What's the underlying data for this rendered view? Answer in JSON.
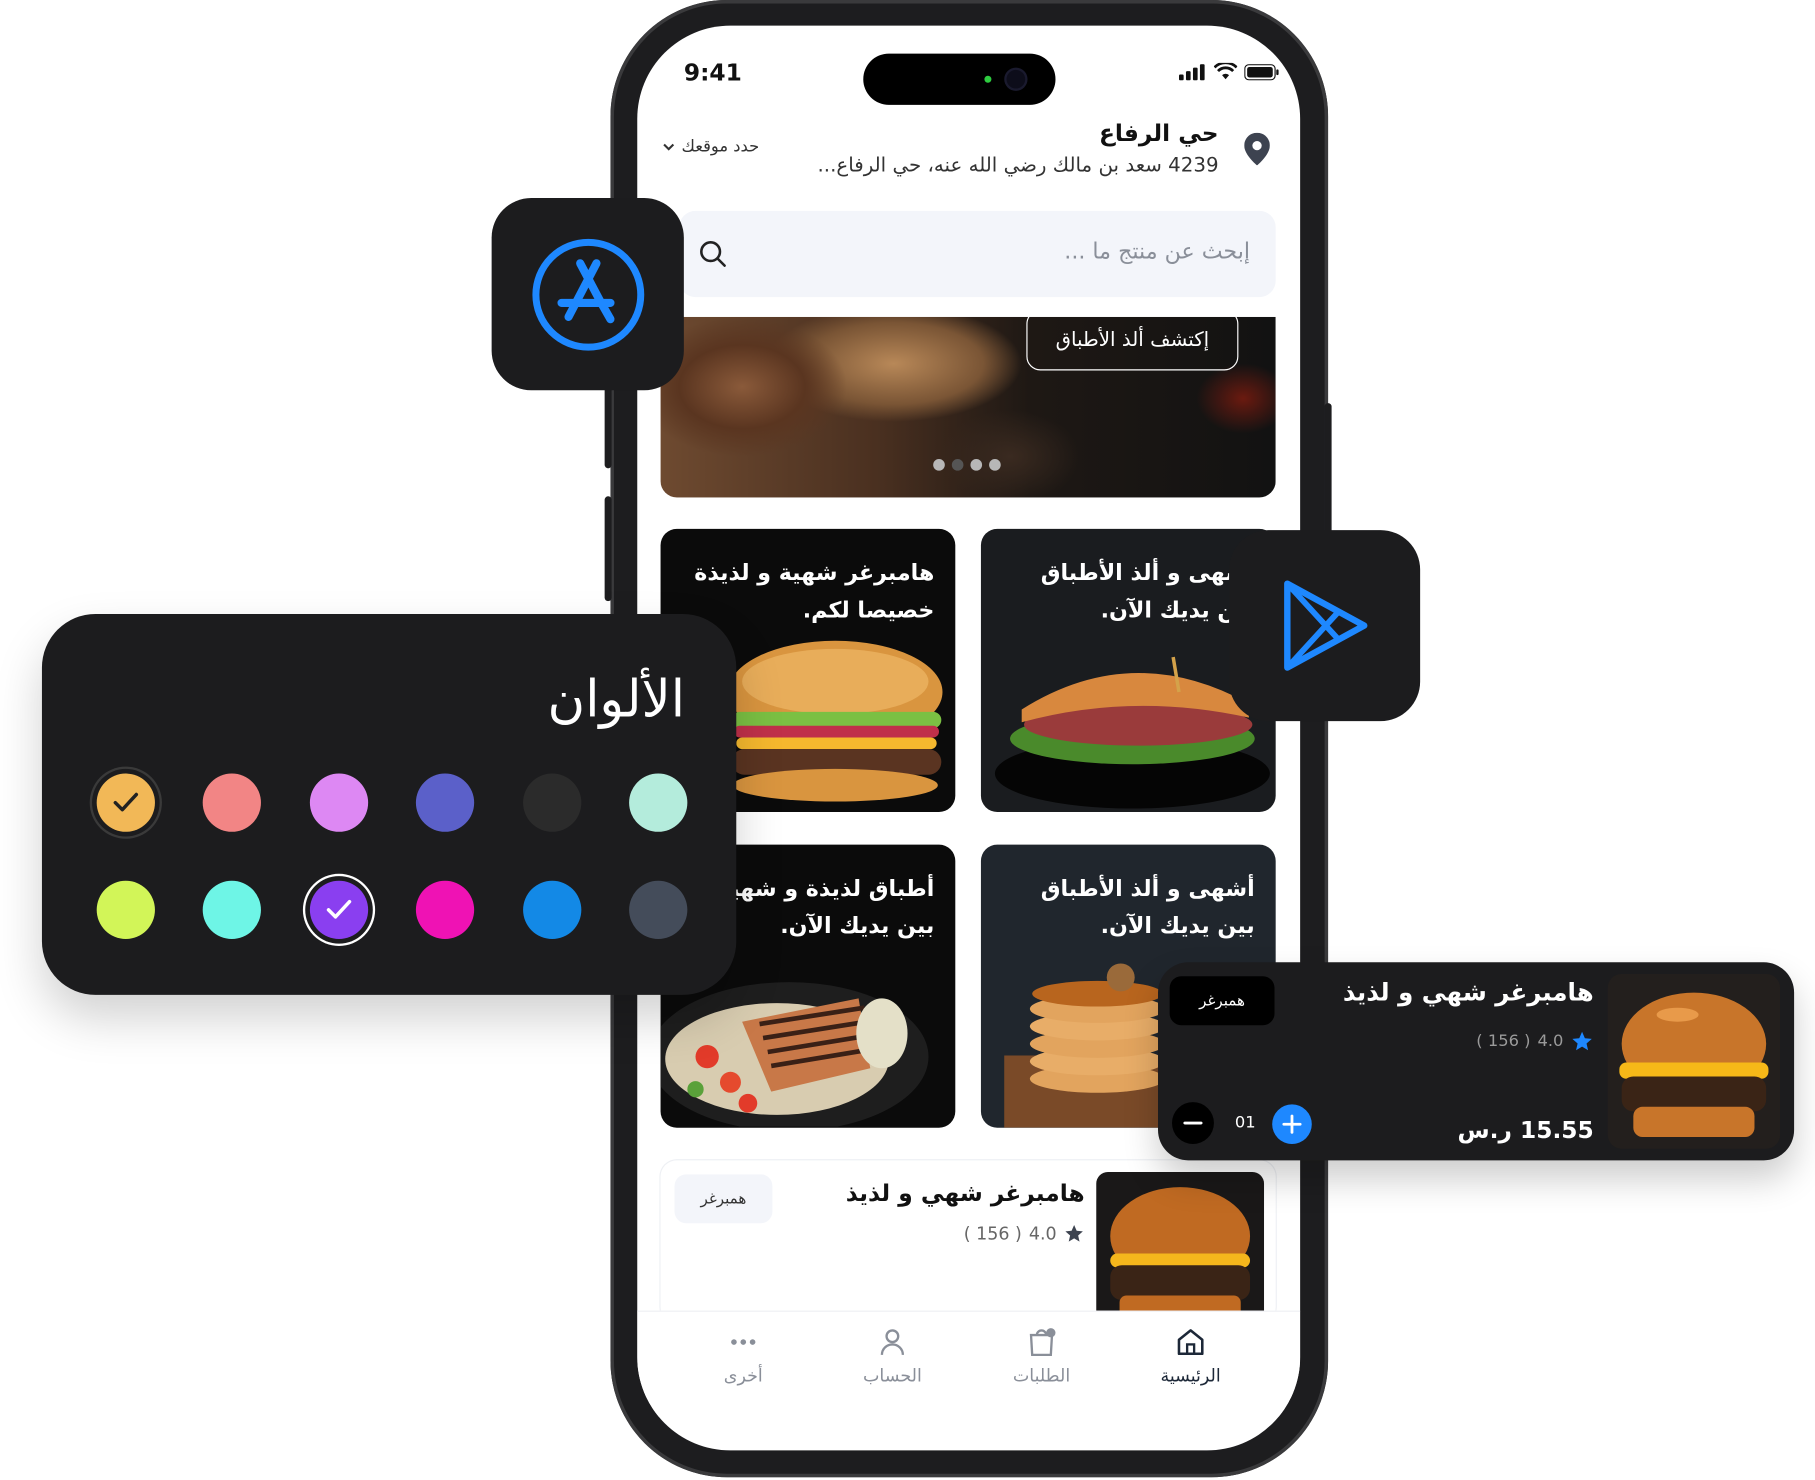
{
  "status": {
    "time": "9:41"
  },
  "location": {
    "title": "حي الرفاع",
    "address": "4239 سعد بن مالك رضي الله عنه، حي الرفاع...",
    "select_label": "حدد موقعك"
  },
  "search": {
    "placeholder": "إبحث عن منتج ما ..."
  },
  "hero": {
    "button": "إكتشف ألذ الأطباق",
    "dots": 4,
    "active_dot": 1
  },
  "cards": [
    {
      "text": "هامبرغر شهية و لذيذة خصيصا لكم."
    },
    {
      "text": "أشهى و ألذ الأطباق بين يديك الآن."
    },
    {
      "text": "أطباق لذيذة و شهية بين يديك الآن."
    },
    {
      "text": "أشهى و ألذ الأطباق بين يديك الآن."
    }
  ],
  "product": {
    "name": "هامبرغر شهي و لذيذ",
    "rating": "4.0",
    "reviews": "( 156 )",
    "tag": "همبرغر"
  },
  "tabs": [
    {
      "label": "الرئيسية",
      "icon": "home-icon",
      "active": true
    },
    {
      "label": "الطلبات",
      "icon": "orders-icon",
      "active": false
    },
    {
      "label": "الحساب",
      "icon": "user-icon",
      "active": false
    },
    {
      "label": "أخرى",
      "icon": "more-icon",
      "active": false
    }
  ],
  "colors_panel": {
    "title": "الألوان",
    "swatches": [
      "#f2b857",
      "#f28585",
      "#dd88f3",
      "#5b60c9",
      "#2b2b2b",
      "#b4ecdc",
      "#d2f558",
      "#6ef5e6",
      "#8a3ff0",
      "#ef12b4",
      "#1389e6",
      "#444c5a"
    ],
    "selected": [
      0,
      8
    ]
  },
  "floating_card": {
    "name": "هامبرغر شهي و لذيذ",
    "rating": "4.0",
    "reviews": "( 156 )",
    "tag": "همبرغر",
    "price": "15.55 ر.س",
    "quantity": "01",
    "accent": "#1e88ff"
  },
  "icons": {
    "app_store": "app-store-icon",
    "play_store": "google-play-icon"
  }
}
